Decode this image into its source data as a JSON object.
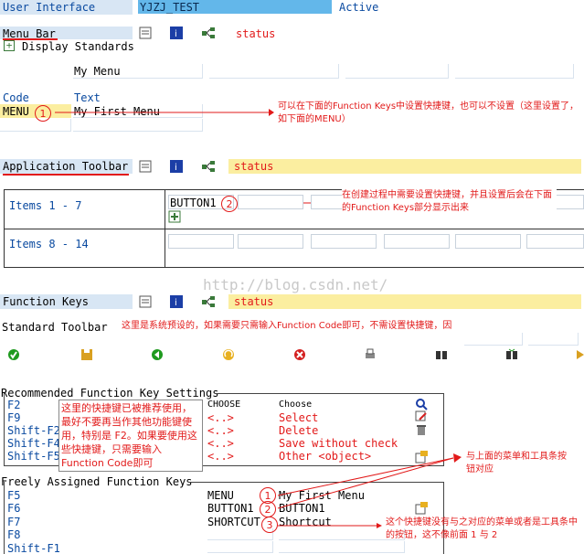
{
  "header": {
    "ui_label": "User Interface",
    "program": "YJZJ_TEST",
    "state": "Active"
  },
  "menubar": {
    "label": "Menu Bar",
    "status": "status",
    "display_standards": "Display Standards",
    "menu_name": "My Menu",
    "code_label": "Code",
    "text_label": "Text",
    "code_value": "MENU",
    "text_value": "My First Menu",
    "note": "可以在下面的Function Keys中设置快捷键，也可以不设置（这里设置了，如下面的MENU）"
  },
  "apptoolbar": {
    "label": "Application Toolbar",
    "status": "status",
    "items1": "Items  1 -  7",
    "items2": "Items  8 - 14",
    "button1": "BUTTON1",
    "note": "在创建过程中需要设置快捷键，并且设置后会在下面的Function Keys部分显示出来"
  },
  "watermark": "http://blog.csdn.net/",
  "fkeys": {
    "label": "Function Keys",
    "status": "status"
  },
  "stdtoolbar": {
    "label": "Standard Toolbar",
    "note": "这里是系统预设的，如果需要只需输入Function Code即可，不需设置快捷键，因为系统也已经帮我们设置好了，具体是什么快捷键请参见文档后面部分"
  },
  "recommended": {
    "title": "Recommended Function Key Settings",
    "keys": [
      "F2",
      "F9",
      "Shift-F2",
      "Shift-F4",
      "Shift-F5"
    ],
    "codes": [
      "CHOOSE",
      "<..>",
      "<..>",
      "<..>",
      "<..>"
    ],
    "texts": [
      "Choose",
      "Select",
      "Delete",
      "Save without check",
      "Other <object>"
    ],
    "note": "这里的快捷键已被推荐使用，最好不要再当作其他功能键使用，特别是 F2。如果要使用这些快捷键，只需要输入Function Code即可"
  },
  "freely": {
    "title": "Freely Assigned Function Keys",
    "keys": [
      "F5",
      "F6",
      "F7",
      "F8",
      "Shift-F1"
    ],
    "codes": [
      "MENU",
      "BUTTON1",
      "SHORTCUT",
      "",
      ""
    ],
    "texts": [
      "My First Menu",
      "BUTTON1",
      "Shortcut",
      "",
      ""
    ],
    "note1": "与上面的菜单和工具条按钮对应",
    "note2": "这个快捷键没有与之对应的菜单或者是工具条中的按钮，这不像前面 1 与 2"
  },
  "markers": {
    "one": "1",
    "two": "2",
    "three": "3"
  },
  "colors": {
    "accent_red": "#e21a1a",
    "sap_blue": "#0a4aa0",
    "field_blue": "#d8e6f4",
    "status_yellow": "#fbeea0"
  }
}
